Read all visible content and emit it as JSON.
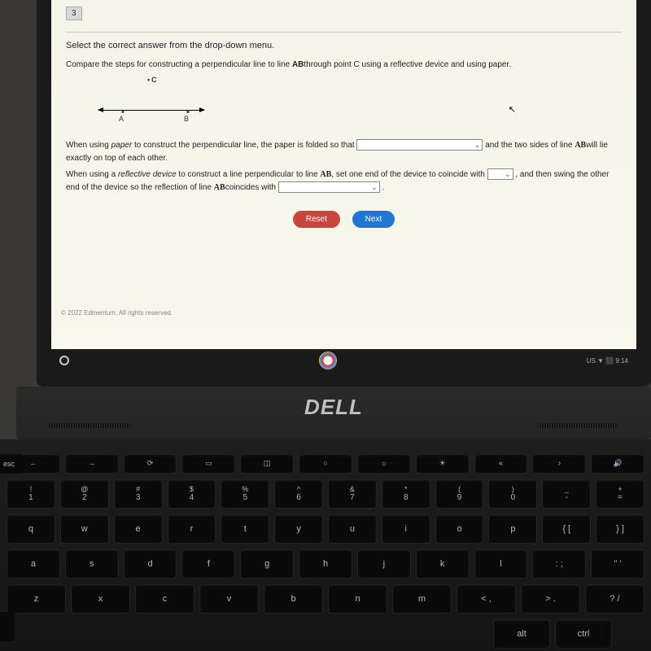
{
  "question": {
    "number": "3",
    "instruction": "Select the correct answer from the drop-down menu.",
    "prompt_pre": "Compare the steps for constructing a perpendicular line to line ",
    "prompt_ab": "AB",
    "prompt_post": "through point C using a reflective device and using paper.",
    "diagram": {
      "point_c": "C",
      "point_a": "A",
      "point_b": "B"
    },
    "para1_pre": "When using ",
    "para1_em": "paper",
    "para1_mid": " to construct the perpendicular line, the paper is folded so that ",
    "para1_post": " and the two sides of line ",
    "para1_ab": "AB",
    "para1_end": "will lie exactly on top of each other.",
    "para2_pre": "When using a ",
    "para2_em": "reflective device",
    "para2_mid": " to construct a line perpendicular to line ",
    "para2_ab": "AB",
    "para2_mid2": ", set one end of the device to coincide with ",
    "para2_and": " , and then swing the other end of the device so the reflection of line ",
    "para2_ab2": "AB",
    "para2_end": "coincides with ",
    "para2_period": " ."
  },
  "buttons": {
    "reset": "Reset",
    "next": "Next"
  },
  "footer": {
    "copyright": "© 2022 Edmentum. All rights reserved."
  },
  "taskbar": {
    "right": "US ▼ ⬛ 9:14"
  },
  "laptop": {
    "brand": "DELL"
  },
  "keyboard": {
    "fn_row": [
      "←",
      "→",
      "⟳",
      "▭",
      "◫",
      "○",
      "☼",
      "☀",
      "«",
      "♪",
      "🔊"
    ],
    "row1": [
      {
        "t": "!",
        "b": "1"
      },
      {
        "t": "@",
        "b": "2"
      },
      {
        "t": "#",
        "b": "3"
      },
      {
        "t": "$",
        "b": "4"
      },
      {
        "t": "%",
        "b": "5"
      },
      {
        "t": "^",
        "b": "6"
      },
      {
        "t": "&",
        "b": "7"
      },
      {
        "t": "*",
        "b": "8"
      },
      {
        "t": "(",
        "b": "9"
      },
      {
        "t": ")",
        "b": "0"
      },
      {
        "t": "_",
        "b": "-"
      },
      {
        "t": "+",
        "b": "="
      }
    ],
    "row2": [
      "q",
      "w",
      "e",
      "r",
      "t",
      "y",
      "u",
      "i",
      "o",
      "p",
      "{ [",
      "} ]"
    ],
    "row3": [
      "a",
      "s",
      "d",
      "f",
      "g",
      "h",
      "j",
      "k",
      "l",
      ": ;",
      "\" '"
    ],
    "row4": [
      "z",
      "x",
      "c",
      "v",
      "b",
      "n",
      "m",
      "< ,",
      "> .",
      "? /"
    ],
    "row5": [
      "alt",
      "ctrl"
    ],
    "esc": "esc"
  }
}
